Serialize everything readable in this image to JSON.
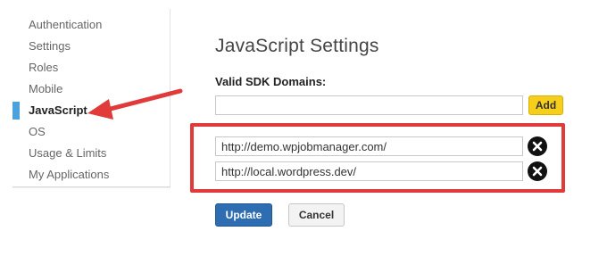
{
  "sidebar": {
    "items": [
      {
        "label": "Authentication"
      },
      {
        "label": "Settings"
      },
      {
        "label": "Roles"
      },
      {
        "label": "Mobile"
      },
      {
        "label": "JavaScript"
      },
      {
        "label": "OS"
      },
      {
        "label": "Usage & Limits"
      },
      {
        "label": "My Applications"
      }
    ],
    "active_index": 4,
    "active_marker_color": "#4aa3df"
  },
  "main": {
    "title": "JavaScript Settings",
    "domains_label": "Valid SDK Domains:",
    "new_domain_input": {
      "value": "",
      "placeholder": ""
    },
    "add_label": "Add",
    "domains": [
      {
        "value": "http://demo.wpjobmanager.com/"
      },
      {
        "value": "http://local.wordpress.dev/"
      }
    ],
    "remove_icon": "close-circle-icon",
    "update_label": "Update",
    "cancel_label": "Cancel"
  },
  "annotations": {
    "highlight_color": "#e03a3a",
    "arrow_color": "#e03a3a"
  },
  "colors": {
    "primary_button": "#2f6db2",
    "add_button": "#f5cf1c"
  }
}
